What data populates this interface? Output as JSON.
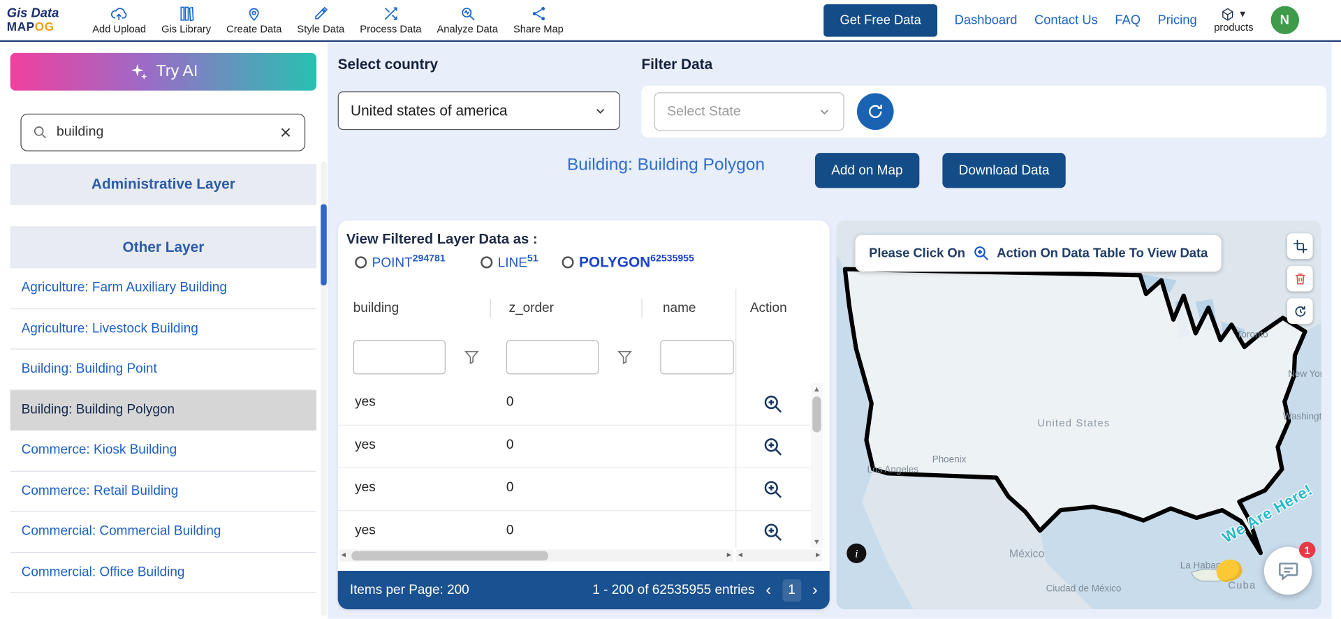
{
  "navbar": {
    "logo": {
      "top": "Gis Data",
      "map": "MAP",
      "og": "OG"
    },
    "items": [
      {
        "label": "Add Upload"
      },
      {
        "label": "Gis Library"
      },
      {
        "label": "Create Data"
      },
      {
        "label": "Style Data"
      },
      {
        "label": "Process Data"
      },
      {
        "label": "Analyze Data"
      },
      {
        "label": "Share Map"
      }
    ],
    "cta": "Get Free Data",
    "links": [
      {
        "label": "Dashboard"
      },
      {
        "label": "Contact Us"
      },
      {
        "label": "FAQ"
      },
      {
        "label": "Pricing"
      }
    ],
    "products": "products",
    "avatar": "N"
  },
  "sidebar": {
    "try_ai": "Try AI",
    "search_value": "building",
    "section1": "Administrative Layer",
    "section2": "Other Layer",
    "items": [
      {
        "label": "Agriculture: Farm Auxiliary Building",
        "selected": false
      },
      {
        "label": "Agriculture: Livestock Building",
        "selected": false
      },
      {
        "label": "Building: Building Point",
        "selected": false
      },
      {
        "label": "Building: Building Polygon",
        "selected": true
      },
      {
        "label": "Commerce: Kiosk Building",
        "selected": false
      },
      {
        "label": "Commerce: Retail Building",
        "selected": false
      },
      {
        "label": "Commercial: Commercial Building",
        "selected": false
      },
      {
        "label": "Commercial: Office Building",
        "selected": false
      }
    ]
  },
  "filters": {
    "country_label": "Select country",
    "country_value": "United states of america",
    "filter_label": "Filter Data",
    "state_placeholder": "Select State"
  },
  "detail": {
    "title": "Building: Building Polygon",
    "add_btn": "Add on Map",
    "download_btn": "Download Data"
  },
  "table": {
    "view_label": "View Filtered Layer Data as :",
    "radios": [
      {
        "label": "POINT",
        "count": "294781",
        "selected": false
      },
      {
        "label": "LINE",
        "count": "51",
        "selected": false
      },
      {
        "label": "POLYGON",
        "count": "62535955",
        "selected": true
      }
    ],
    "columns": [
      {
        "label": "building"
      },
      {
        "label": "z_order"
      },
      {
        "label": "name"
      },
      {
        "label": "Action"
      }
    ],
    "rows": [
      {
        "building": "yes",
        "z_order": "0",
        "name": ""
      },
      {
        "building": "yes",
        "z_order": "0",
        "name": ""
      },
      {
        "building": "yes",
        "z_order": "0",
        "name": ""
      },
      {
        "building": "yes",
        "z_order": "0",
        "name": ""
      }
    ],
    "footer": {
      "items_per_page": "Items per Page: 200",
      "range": "1 - 200 of 62535955 entries",
      "page": "1"
    }
  },
  "map": {
    "notice_pre": "Please Click On",
    "notice_post": "Action On Data Table To View Data",
    "labels": [
      {
        "text": "Toronto"
      },
      {
        "text": "United States"
      },
      {
        "text": "Phoenix"
      },
      {
        "text": "Los Angeles"
      },
      {
        "text": "Washington"
      },
      {
        "text": "New York"
      },
      {
        "text": "México"
      },
      {
        "text": "Ciudad de México"
      },
      {
        "text": "La Habana"
      },
      {
        "text": "Cuba"
      }
    ],
    "here_text": "We Are Here!",
    "chat_badge": "1"
  },
  "colors": {
    "primary_navy": "#134c87",
    "footer_navy": "#1a5190",
    "link_blue": "#1b63c5",
    "title_blue": "#2d6ecf",
    "gradient_pink": "#f0409f",
    "gradient_teal": "#28c0b2",
    "avatar_green": "#3d9b4a",
    "danger_red": "#e05252",
    "badge_red": "#e53945",
    "here_teal": "#28b8cc"
  }
}
